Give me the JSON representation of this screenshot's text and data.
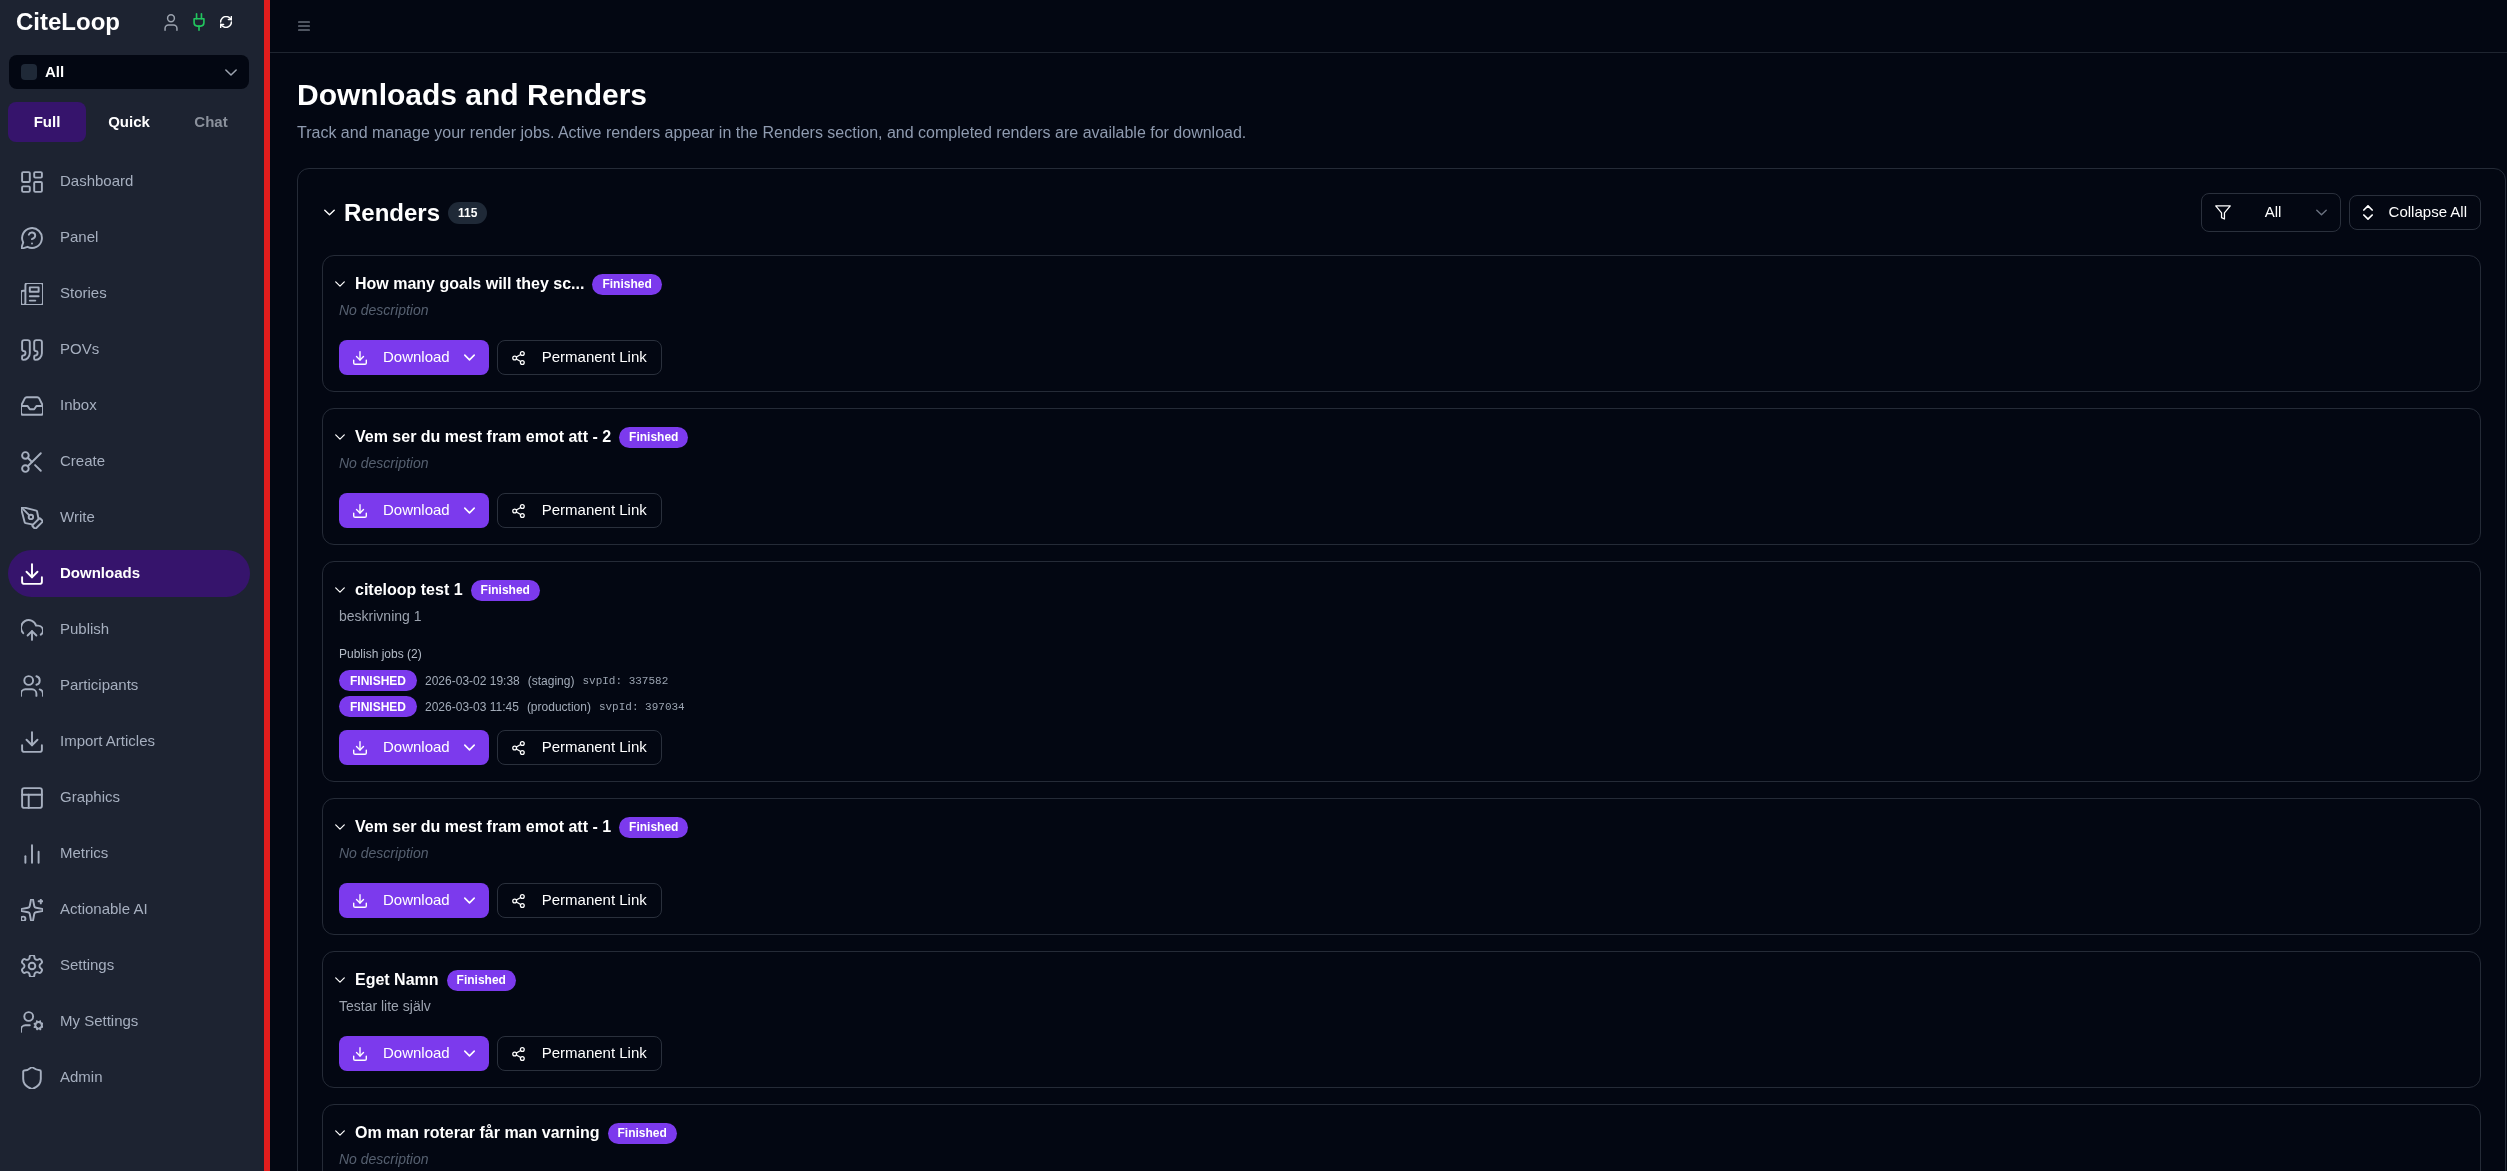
{
  "sidebar": {
    "logo": "CiteLoop",
    "connected": true,
    "workspace": {
      "value": "All"
    },
    "modes": [
      {
        "label": "Full",
        "selected": true,
        "disabled": false
      },
      {
        "label": "Quick",
        "selected": false,
        "disabled": false
      },
      {
        "label": "Chat",
        "selected": false,
        "disabled": true
      }
    ],
    "nav": [
      {
        "label": "Dashboard",
        "selected": false
      },
      {
        "label": "Panel",
        "selected": false
      },
      {
        "label": "Stories",
        "selected": false
      },
      {
        "label": "POVs",
        "selected": false
      },
      {
        "label": "Inbox",
        "selected": false
      },
      {
        "label": "Create",
        "selected": false
      },
      {
        "label": "Write",
        "selected": false
      },
      {
        "label": "Downloads",
        "selected": true
      },
      {
        "label": "Publish",
        "selected": false
      },
      {
        "label": "Participants",
        "selected": false
      },
      {
        "label": "Import Articles",
        "selected": false
      },
      {
        "label": "Graphics",
        "selected": false
      },
      {
        "label": "Metrics",
        "selected": false
      },
      {
        "label": "Actionable AI",
        "selected": false
      },
      {
        "label": "Settings",
        "selected": false
      },
      {
        "label": "My Settings",
        "selected": false
      },
      {
        "label": "Admin",
        "selected": false
      }
    ]
  },
  "page": {
    "title": "Downloads and Renders",
    "subtitle": "Track and manage your render jobs. Active renders appear in the Renders section, and completed renders are available for download."
  },
  "renders": {
    "title": "Renders",
    "count": "115",
    "expanded": true,
    "filter": {
      "value": "All"
    },
    "collapse_button": "Collapse All",
    "items": [
      {
        "title": "How many goals will they sc...",
        "status": "Finished",
        "expanded": true,
        "description": "No description",
        "description_empty": true,
        "download_button": "Download",
        "link_button": "Permanent Link"
      },
      {
        "title": "Vem ser du mest fram emot att - 2",
        "status": "Finished",
        "expanded": true,
        "description": "No description",
        "description_empty": true,
        "download_button": "Download",
        "link_button": "Permanent Link"
      },
      {
        "title": "citeloop test 1",
        "status": "Finished",
        "expanded": true,
        "description": "beskrivning 1",
        "description_empty": false,
        "publish_jobs": {
          "label": "Publish jobs (2)",
          "jobs": [
            {
              "status": "FINISHED",
              "time": "2026-03-02 19:38",
              "environment": "(staging)",
              "svp_id": "svpId: 337582"
            },
            {
              "status": "FINISHED",
              "time": "2026-03-03 11:45",
              "environment": "(production)",
              "svp_id": "svpId: 397034"
            }
          ]
        },
        "download_button": "Download",
        "link_button": "Permanent Link"
      },
      {
        "title": "Vem ser du mest fram emot att - 1",
        "status": "Finished",
        "expanded": true,
        "description": "No description",
        "description_empty": true,
        "download_button": "Download",
        "link_button": "Permanent Link"
      },
      {
        "title": "Eget Namn",
        "status": "Finished",
        "expanded": true,
        "description": "Testar lite själv",
        "description_empty": false,
        "download_button": "Download",
        "link_button": "Permanent Link"
      },
      {
        "title": "Om man roterar får man varning",
        "status": "Finished",
        "expanded": true,
        "description": "No description",
        "description_empty": true
      }
    ]
  }
}
